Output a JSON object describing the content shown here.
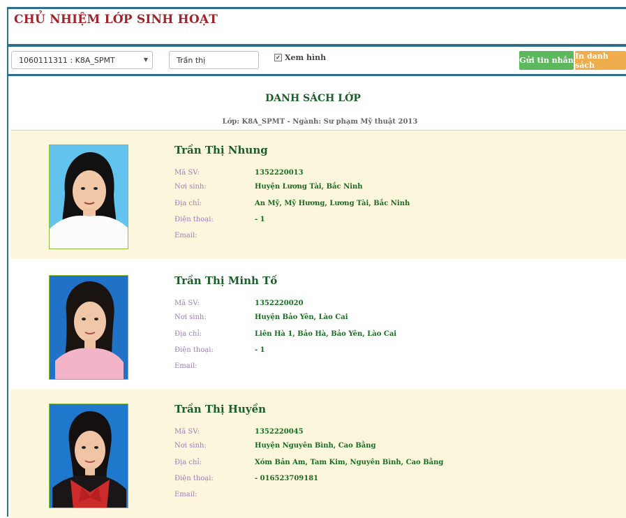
{
  "header": {
    "title": "CHỦ NHIỆM LỚP SINH HOẠT"
  },
  "toolbar": {
    "class_select_value": "1060111311 : K8A_SPMT",
    "search_value": "Trần thị",
    "show_photo_label": "Xem hình",
    "show_photo_checked": true,
    "send_button": "Gửi tin nhắn",
    "print_button": "In danh sách"
  },
  "main": {
    "title": "DANH SÁCH LỚP",
    "subtitle": "Lớp: K8A_SPMT - Ngành: Sư phạm Mỹ thuật 2013"
  },
  "labels": {
    "student_id": "Mã SV:",
    "birthplace": "Nơi sinh:",
    "address": "Địa chỉ:",
    "phone": "Điện thoại:",
    "email": "Email:"
  },
  "students": [
    {
      "name": "Trần Thị Nhung",
      "student_id": "1352220013",
      "birthplace": "Huyện Lương Tài, Bắc Ninh",
      "address": "An Mỹ, Mỹ Hương, Lương Tài, Bắc Ninh",
      "phone": "- 1",
      "email": ""
    },
    {
      "name": "Trần Thị Minh Tố",
      "student_id": "1352220020",
      "birthplace": "Huyện Bảo Yên, Lào Cai",
      "address": "Liên Hà 1, Bảo Hà, Bảo Yên, Lào Cai",
      "phone": "- 1",
      "email": ""
    },
    {
      "name": "Trần Thị Huyền",
      "student_id": "1352220045",
      "birthplace": "Huyện Nguyên Bình, Cao Bằng",
      "address": "Xóm Bản Am, Tam Kim, Nguyên Bình, Cao Bằng",
      "phone": "- 016523709181",
      "email": ""
    }
  ],
  "colors": {
    "title_red": "#a0252b",
    "green_text": "#1a5e2a",
    "row_highlight": "#fcf6dd",
    "send_button": "#5cb85c",
    "print_button": "#f0ad4e"
  },
  "icons": {
    "dropdown": "chevron-down-icon",
    "checkbox": "checkbox-checked-icon"
  }
}
